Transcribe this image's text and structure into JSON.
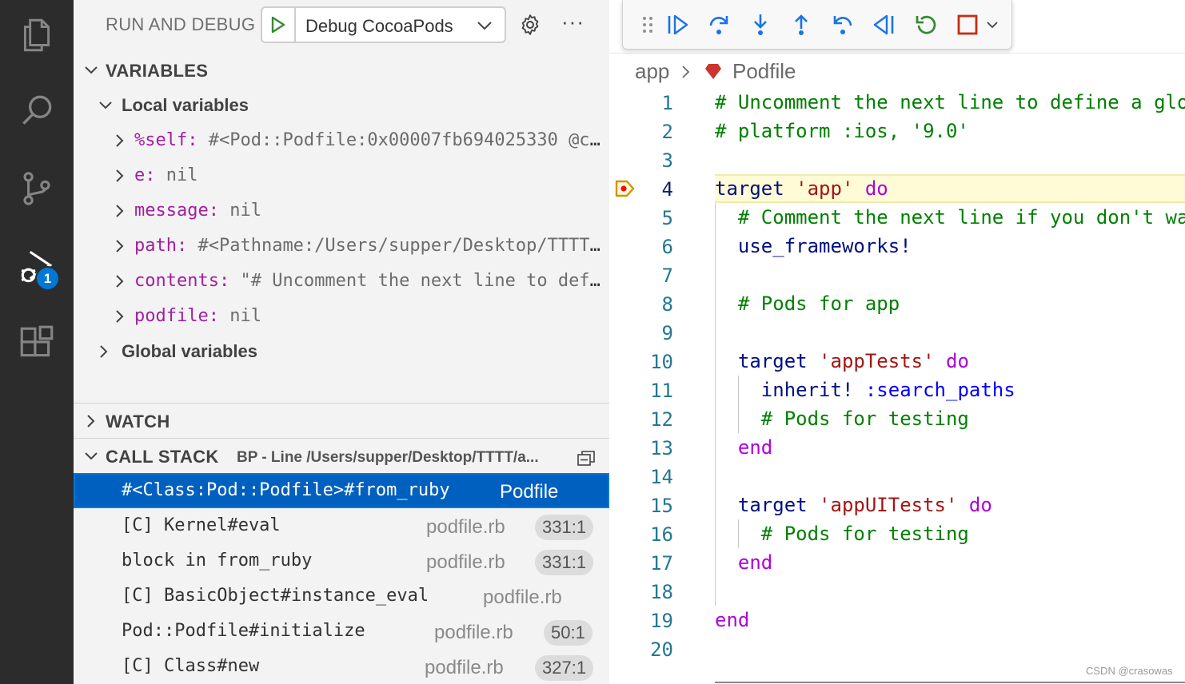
{
  "activity_bar": {
    "icons": [
      "explorer-icon",
      "search-icon",
      "source-control-icon",
      "run-debug-icon",
      "extensions-icon"
    ],
    "debug_badge": "1"
  },
  "sidebar": {
    "title": "RUN AND DEBUG",
    "config": {
      "selected": "Debug CocoaPods"
    },
    "variables": {
      "header": "VARIABLES",
      "local_group": "Local variables",
      "locals": [
        {
          "name": "%self:",
          "value": " #<Pod::Podfile:0x00007fb694025330 @cu…"
        },
        {
          "name": "e:",
          "value": " nil"
        },
        {
          "name": "message:",
          "value": " nil"
        },
        {
          "name": "path:",
          "value": " #<Pathname:/Users/supper/Desktop/TTTT/…"
        },
        {
          "name": "contents:",
          "value": " \"# Uncomment the next line to defi…"
        },
        {
          "name": "podfile:",
          "value": " nil"
        }
      ],
      "global_group": "Global variables"
    },
    "watch": {
      "header": "WATCH"
    },
    "call_stack": {
      "header": "CALL STACK",
      "subtitle": "BP - Line /Users/supper/Desktop/TTTT/a...",
      "frames": [
        {
          "name": "#<Class:Pod::Podfile>#from_ruby",
          "file": "Podfile",
          "pos": ""
        },
        {
          "name": "[C] Kernel#eval",
          "file": "podfile.rb",
          "pos": "331:1"
        },
        {
          "name": "block in from_ruby",
          "file": "podfile.rb",
          "pos": "331:1"
        },
        {
          "name": "[C] BasicObject#instance_eval",
          "file": "podfile.rb",
          "pos": ""
        },
        {
          "name": "Pod::Podfile#initialize",
          "file": "podfile.rb",
          "pos": "50:1"
        },
        {
          "name": "[C] Class#new",
          "file": "podfile.rb",
          "pos": "327:1"
        }
      ]
    }
  },
  "editor": {
    "breadcrumb": {
      "folder": "app",
      "file": "Podfile"
    },
    "current_line": 4,
    "lines": [
      {
        "n": "1",
        "tokens": [
          {
            "t": "# Uncomment the next line to define a glo",
            "c": "com"
          }
        ]
      },
      {
        "n": "2",
        "tokens": [
          {
            "t": "# platform :ios, '9.0'",
            "c": "com"
          }
        ]
      },
      {
        "n": "3",
        "tokens": []
      },
      {
        "n": "4",
        "tokens": [
          {
            "t": "target ",
            "c": "id"
          },
          {
            "t": "'app'",
            "c": "str"
          },
          {
            "t": " do",
            "c": "kw"
          }
        ]
      },
      {
        "n": "5",
        "tokens": [
          {
            "t": "  # Comment the next line if you don't wa",
            "c": "com"
          }
        ]
      },
      {
        "n": "6",
        "tokens": [
          {
            "t": "  use_frameworks!",
            "c": "id"
          }
        ]
      },
      {
        "n": "7",
        "tokens": []
      },
      {
        "n": "8",
        "tokens": [
          {
            "t": "  # Pods for app",
            "c": "com"
          }
        ]
      },
      {
        "n": "9",
        "tokens": []
      },
      {
        "n": "10",
        "tokens": [
          {
            "t": "  target ",
            "c": "id"
          },
          {
            "t": "'appTests'",
            "c": "str"
          },
          {
            "t": " do",
            "c": "kw"
          }
        ]
      },
      {
        "n": "11",
        "tokens": [
          {
            "t": "    inherit! ",
            "c": "id"
          },
          {
            "t": ":search_paths",
            "c": "sym"
          }
        ]
      },
      {
        "n": "12",
        "tokens": [
          {
            "t": "    # Pods for testing",
            "c": "com"
          }
        ]
      },
      {
        "n": "13",
        "tokens": [
          {
            "t": "  end",
            "c": "kw"
          }
        ]
      },
      {
        "n": "14",
        "tokens": []
      },
      {
        "n": "15",
        "tokens": [
          {
            "t": "  target ",
            "c": "id"
          },
          {
            "t": "'appUITests'",
            "c": "str"
          },
          {
            "t": " do",
            "c": "kw"
          }
        ]
      },
      {
        "n": "16",
        "tokens": [
          {
            "t": "    # Pods for testing",
            "c": "com"
          }
        ]
      },
      {
        "n": "17",
        "tokens": [
          {
            "t": "  end",
            "c": "kw"
          }
        ]
      },
      {
        "n": "18",
        "tokens": []
      },
      {
        "n": "19",
        "tokens": [
          {
            "t": "end",
            "c": "kw"
          }
        ]
      },
      {
        "n": "20",
        "tokens": []
      }
    ]
  },
  "debug_toolbar": {
    "buttons": [
      "drag-handle",
      "continue",
      "step-over",
      "step-into",
      "step-out",
      "step-back",
      "reverse-continue",
      "restart",
      "stop"
    ]
  },
  "watermark": "CSDN @crasowas",
  "colors": {
    "selection": "#0060c0",
    "accent": "#0078d4",
    "current_line": "#fffbd6"
  }
}
